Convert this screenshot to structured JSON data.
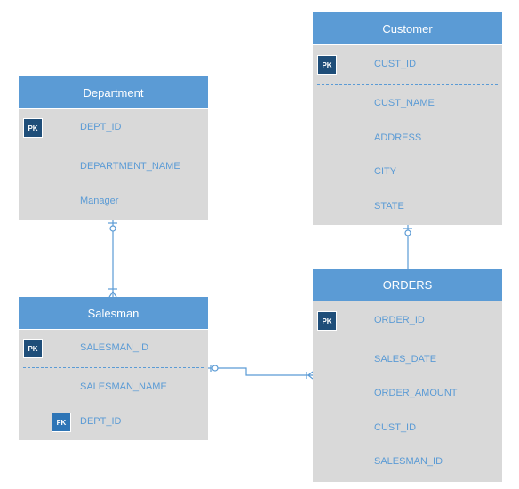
{
  "entities": {
    "department": {
      "title": "Department",
      "pk": "PK",
      "attrs": [
        "DEPT_ID",
        "DEPARTMENT_NAME",
        "Manager"
      ]
    },
    "salesman": {
      "title": "Salesman",
      "pk": "PK",
      "fk": "FK",
      "attrs": [
        "SALESMAN_ID",
        "SALESMAN_NAME",
        "DEPT_ID"
      ]
    },
    "customer": {
      "title": "Customer",
      "pk": "PK",
      "attrs": [
        "CUST_ID",
        "CUST_NAME",
        "ADDRESS",
        "CITY",
        "STATE"
      ]
    },
    "orders": {
      "title": "ORDERS",
      "pk": "PK",
      "attrs": [
        "ORDER_ID",
        "SALES_DATE",
        "ORDER_AMOUNT",
        "CUST_ID",
        "SALESMAN_ID"
      ]
    }
  },
  "colors": {
    "header": "#5b9bd5",
    "body": "#d9d9d9",
    "pk": "#1f4e79",
    "fk": "#2e75b6"
  }
}
